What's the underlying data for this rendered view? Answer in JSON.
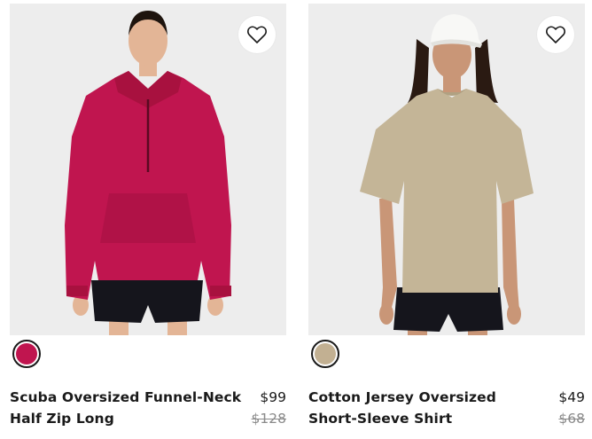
{
  "products": [
    {
      "name": "Scuba Oversized Funnel-Neck Half Zip Long",
      "price": "$99",
      "original_price": "$128",
      "favorite_icon": "heart-outline-icon",
      "swatch_color": "#c0154f",
      "garment_color": "#c0154f",
      "background_color": "#ededed"
    },
    {
      "name": "Cotton Jersey Oversized Short-Sleeve Shirt",
      "price": "$49",
      "original_price": "$68",
      "favorite_icon": "heart-outline-icon",
      "swatch_color": "#c2b092",
      "garment_color": "#c4b597",
      "background_color": "#ededed"
    }
  ]
}
